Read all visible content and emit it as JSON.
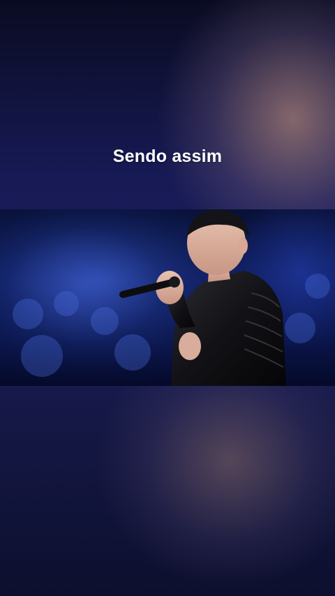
{
  "caption": {
    "text": "Sendo assim"
  },
  "colors": {
    "background_top": "#0a0b22",
    "background_mid": "#1c1f5e",
    "caption_text": "#ffffff",
    "stage_blue": "#0d1a5a"
  },
  "video": {
    "icon": "singer-performance-image"
  }
}
